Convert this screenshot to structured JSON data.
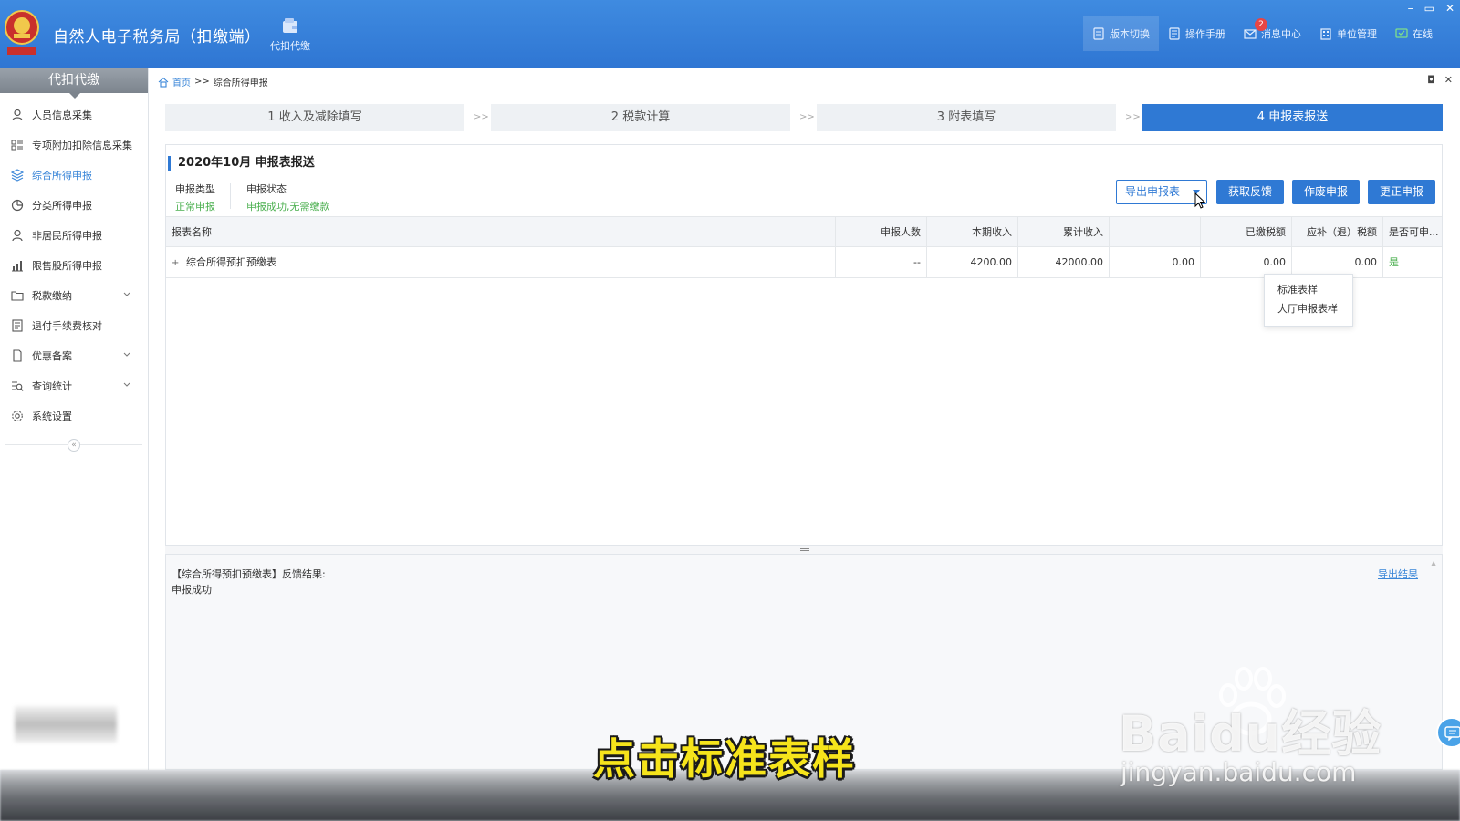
{
  "app": {
    "title": "自然人电子税务局（扣缴端）",
    "module_label": "代扣代缴",
    "logo_text": "中国税务"
  },
  "top_actions": [
    {
      "label": "版本切换",
      "icon": "version-icon"
    },
    {
      "label": "操作手册",
      "icon": "manual-icon"
    },
    {
      "label": "消息中心",
      "icon": "mail-icon",
      "badge": "2"
    },
    {
      "label": "单位管理",
      "icon": "building-icon"
    },
    {
      "label": "在线",
      "icon": "online-icon"
    }
  ],
  "window_controls": [
    "–",
    "▭",
    "✕"
  ],
  "sidebar": {
    "header": "代扣代缴",
    "items": [
      {
        "label": "人员信息采集",
        "icon": "person-icon"
      },
      {
        "label": "专项附加扣除信息采集",
        "icon": "list-icon"
      },
      {
        "label": "综合所得申报",
        "icon": "layers-icon",
        "active": true
      },
      {
        "label": "分类所得申报",
        "icon": "pie-icon"
      },
      {
        "label": "非居民所得申报",
        "icon": "person-outline-icon"
      },
      {
        "label": "限售股所得申报",
        "icon": "bar-chart-icon"
      },
      {
        "label": "税款缴纳",
        "icon": "folder-icon",
        "expandable": true
      },
      {
        "label": "退付手续费核对",
        "icon": "doc-check-icon"
      },
      {
        "label": "优惠备案",
        "icon": "file-icon",
        "expandable": true
      },
      {
        "label": "查询统计",
        "icon": "search-list-icon",
        "expandable": true
      },
      {
        "label": "系统设置",
        "icon": "gear-icon"
      }
    ],
    "collapse_symbol": "«"
  },
  "breadcrumb": {
    "home": "首页",
    "separator": ">>",
    "current": "综合所得申报"
  },
  "content_controls": [
    "◘",
    "✕"
  ],
  "steps": [
    {
      "label": "1 收入及减除填写",
      "active": false
    },
    {
      "label": "2 税款计算",
      "active": false
    },
    {
      "label": "3 附表填写",
      "active": false
    },
    {
      "label": "4 申报表报送",
      "active": true
    }
  ],
  "step_separator": ">>",
  "panel": {
    "title": "2020年10月  申报表报送",
    "declare_type_label": "申报类型",
    "declare_type_value": "正常申报",
    "declare_status_label": "申报状态",
    "declare_status_value": "申报成功,无需缴款"
  },
  "actions": {
    "export": "导出申报表",
    "feedback": "获取反馈",
    "void": "作废申报",
    "correct": "更正申报"
  },
  "export_menu": [
    "标准表样",
    "大厅申报表样"
  ],
  "table": {
    "headers": [
      "报表名称",
      "申报人数",
      "本期收入",
      "累计收入",
      "",
      "已缴税额",
      "应补（退）税额",
      "是否可申..."
    ],
    "rows": [
      {
        "expander": "+",
        "name": "综合所得预扣预缴表",
        "people": "--",
        "current_income": "4200.00",
        "cumulative_income": "42000.00",
        "col5": "0.00",
        "paid_tax": "0.00",
        "refund_tax": "0.00",
        "can_declare": "是"
      }
    ]
  },
  "feedback": {
    "line1": "【综合所得预扣预缴表】反馈结果:",
    "line2": "申报成功",
    "export_link": "导出结果"
  },
  "overlay": {
    "subtitle": "点击标准表样",
    "watermark_main": "Baidu经验",
    "watermark_url": "jingyan.baidu.com"
  },
  "colors": {
    "primary": "#2f79d4",
    "success": "#4cb050",
    "subtitle": "#f6e41b"
  }
}
